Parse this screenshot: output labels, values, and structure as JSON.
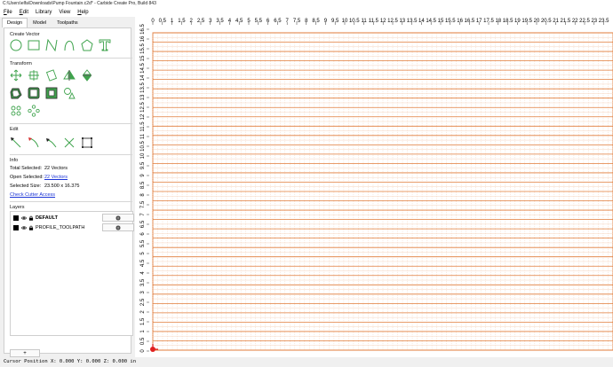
{
  "window": {
    "title": "C:\\Users\\elfa\\Downloads\\Pump Fountain.c2d* - Carbide Create Pro, Build 843"
  },
  "menu": [
    {
      "underline": "F",
      "rest": "ile"
    },
    {
      "underline": "E",
      "rest": "dit"
    },
    {
      "underline": "",
      "rest": "Library"
    },
    {
      "underline": "",
      "rest": "View"
    },
    {
      "underline": "H",
      "rest": "elp"
    }
  ],
  "tabs": [
    "Design",
    "Model",
    "Toolpaths"
  ],
  "active_tab": "Design",
  "sections": {
    "create_vector": "Create Vector",
    "transform": "Transform",
    "edit": "Edit",
    "info": "Info",
    "layers": "Layers"
  },
  "info": {
    "total_selected_label": "Total Selected:",
    "total_selected_value": "22 Vectors",
    "open_selected_label": "Open Selected:",
    "open_selected_value": "22 Vectors",
    "selected_size_label": "Selected Size:",
    "selected_size_value": "23.500 x 16.375",
    "check_cutter_access": "Check Cutter Access"
  },
  "layers": [
    {
      "name": "DEFAULT",
      "bold": true,
      "color": "#000000"
    },
    {
      "name": "PROFILE_TOOLPATH",
      "bold": false,
      "color": "#000000"
    }
  ],
  "add_layer_label": "+",
  "canvas": {
    "x_ticks": [
      "0",
      "0.5",
      "1",
      "1.5",
      "2",
      "2.5",
      "3",
      "3.5",
      "4",
      "4.5",
      "5",
      "5.5",
      "6",
      "6.5",
      "7",
      "7.5",
      "8",
      "8.5",
      "9",
      "9.5",
      "10",
      "10.5",
      "11",
      "11.5",
      "12",
      "12.5",
      "13",
      "13.5",
      "14",
      "14.5",
      "15",
      "15.5",
      "16",
      "16.5",
      "17",
      "17.5",
      "18",
      "18.5",
      "19",
      "19.5",
      "20",
      "20.5",
      "21",
      "21.5",
      "22",
      "22.5",
      "23",
      "23.5"
    ],
    "y_ticks": [
      "16.5",
      "16",
      "15.5",
      "15",
      "14.5",
      "14",
      "13.5",
      "13",
      "12.5",
      "12",
      "11.5",
      "11",
      "10.5",
      "10",
      "9.5",
      "9",
      "8.5",
      "8",
      "7.5",
      "7",
      "6.5",
      "6",
      "5.5",
      "5",
      "4.5",
      "4",
      "3.5",
      "3",
      "2.5",
      "2",
      "1.5",
      "1",
      "0.5",
      "0"
    ],
    "stock_color": "#e07b39",
    "origin_color": "#e02020"
  },
  "status": {
    "cursor_position": "Cursor Position X: 0.000 Y: 0.000 Z: 0.000 in"
  },
  "colors": {
    "icon_green": "#3fa34d",
    "link_blue": "#1a33d6"
  }
}
